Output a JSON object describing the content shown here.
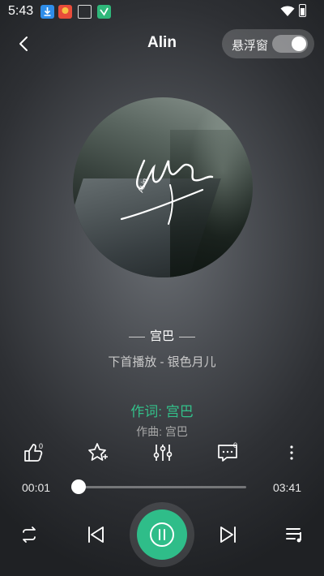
{
  "status_bar": {
    "time": "5:43",
    "icons": [
      "download-icon",
      "red-app-icon",
      "box-icon",
      "green-app-icon",
      "wifi-icon",
      "battery-icon"
    ]
  },
  "header": {
    "title": "Alin",
    "float_window_label": "悬浮窗",
    "float_window_on": true,
    "back_icon": "chevron-left-icon"
  },
  "album": {
    "art_text": "ALin"
  },
  "song": {
    "title": "宫巴",
    "next_up": "下首播放 - 银色月儿"
  },
  "lyrics": {
    "current": "作词: 宫巴",
    "next": "作曲: 宫巴"
  },
  "actions": [
    {
      "name": "like",
      "icon": "thumbs-up-icon",
      "badge": "0"
    },
    {
      "name": "favorite",
      "icon": "star-icon"
    },
    {
      "name": "equalizer",
      "icon": "equalizer-icon"
    },
    {
      "name": "comments",
      "icon": "comment-icon",
      "badge": "0"
    },
    {
      "name": "more",
      "icon": "more-vertical-icon"
    }
  ],
  "progress": {
    "current": "00:01",
    "total": "03:41",
    "fraction": 0.005
  },
  "controls": [
    "repeat-icon",
    "previous-icon",
    "pause-icon",
    "next-icon",
    "playlist-icon"
  ],
  "colors": {
    "accent": "#2fbd89",
    "lyric_active": "#33c08a"
  }
}
